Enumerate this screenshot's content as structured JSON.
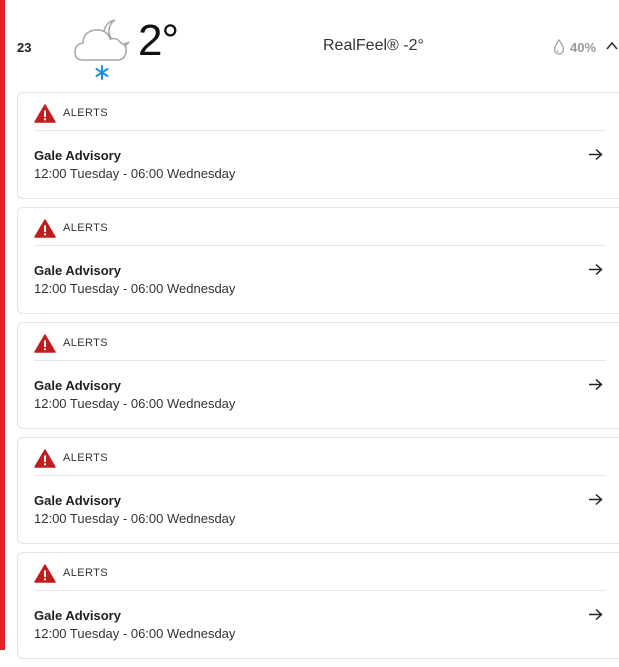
{
  "hourly": {
    "hour": "23",
    "weather_icon": "cloudy-night-snow-icon",
    "temperature": "2°",
    "realfeel": "RealFeel® -2°",
    "precipitation": "40%",
    "precip_icon": "raindrop-icon",
    "toggle_icon": "chevron-up-icon"
  },
  "colors": {
    "accent": "#d62a2a",
    "alert_red": "#c01e1e",
    "snow_blue": "#1e90d6"
  },
  "alerts": [
    {
      "label": "ALERTS",
      "title": "Gale Advisory",
      "time": "12:00 Tuesday - 06:00 Wednesday"
    },
    {
      "label": "ALERTS",
      "title": "Gale Advisory",
      "time": "12:00 Tuesday - 06:00 Wednesday"
    },
    {
      "label": "ALERTS",
      "title": "Gale Advisory",
      "time": "12:00 Tuesday - 06:00 Wednesday"
    },
    {
      "label": "ALERTS",
      "title": "Gale Advisory",
      "time": "12:00 Tuesday - 06:00 Wednesday"
    },
    {
      "label": "ALERTS",
      "title": "Gale Advisory",
      "time": "12:00 Tuesday - 06:00 Wednesday"
    }
  ]
}
